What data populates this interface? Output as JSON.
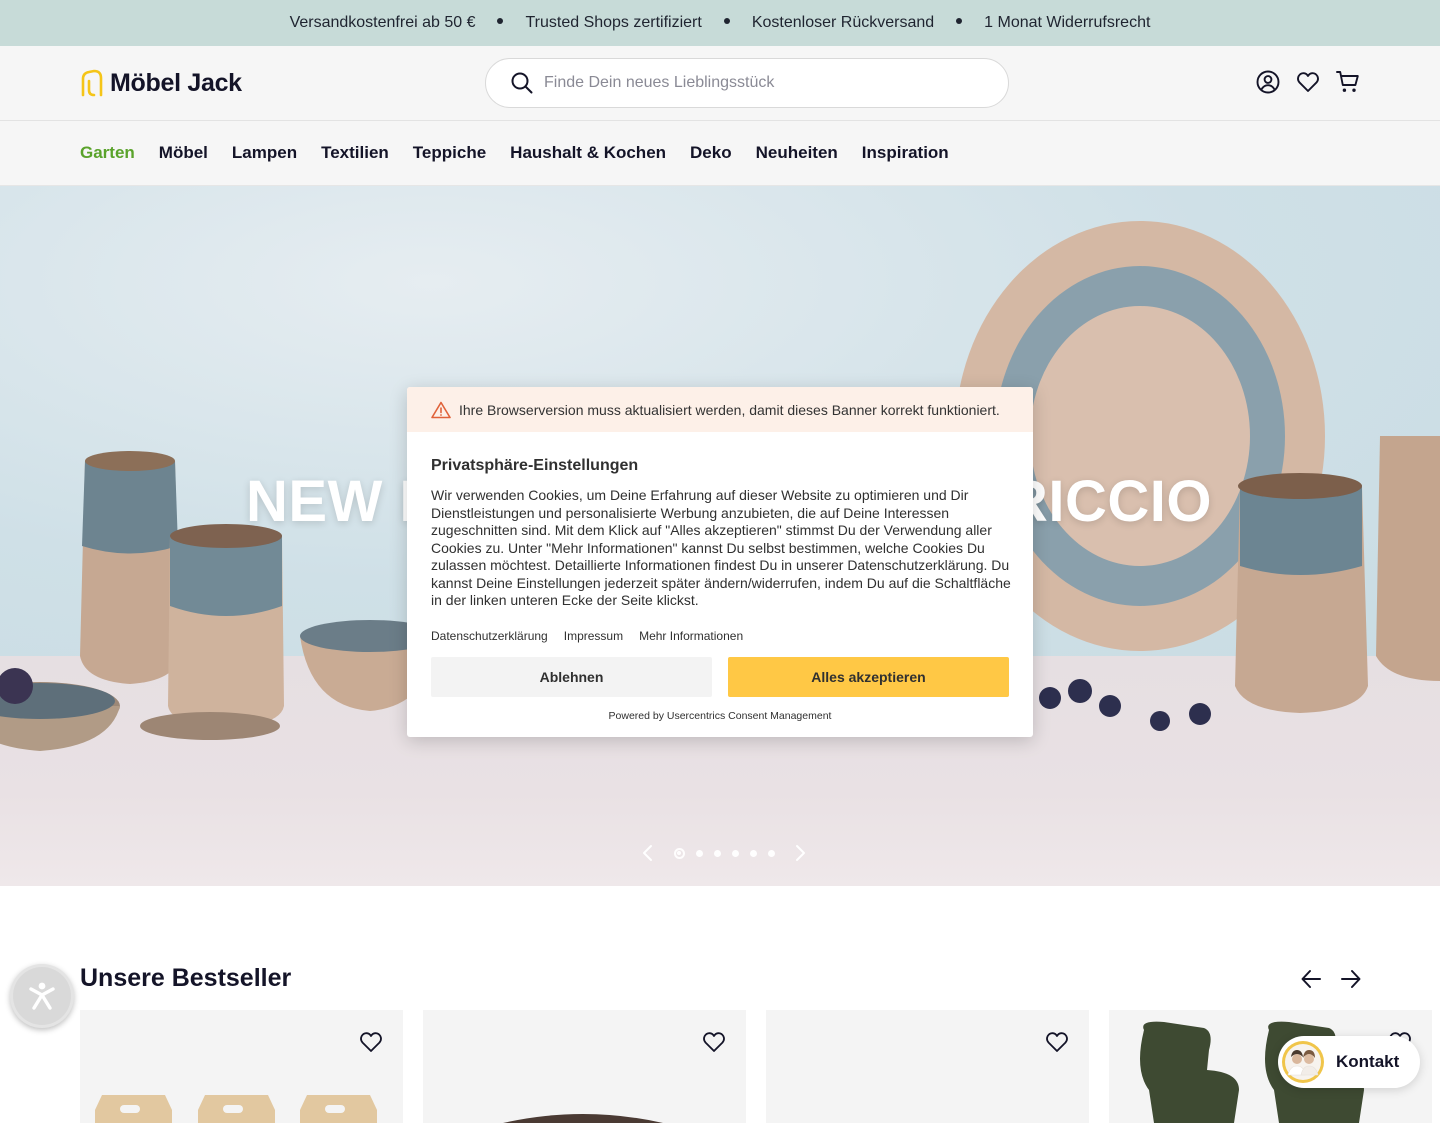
{
  "usp_bar": {
    "items": [
      "Versandkostenfrei ab 50 €",
      "Trusted Shops zertifiziert",
      "Kostenloser Rückversand",
      "1 Monat Widerrufsrecht"
    ]
  },
  "header": {
    "logo_text": "Möbel Jack",
    "search_placeholder": "Finde Dein neues Lieblingsstück",
    "icons": [
      "account-icon",
      "wishlist-icon",
      "cart-icon"
    ]
  },
  "nav": {
    "items": [
      {
        "label": "Garten",
        "active": true
      },
      {
        "label": "Möbel"
      },
      {
        "label": "Lampen"
      },
      {
        "label": "Textilien"
      },
      {
        "label": "Teppiche"
      },
      {
        "label": "Haushalt & Kochen"
      },
      {
        "label": "Deko"
      },
      {
        "label": "Neuheiten"
      },
      {
        "label": "Inspiration"
      }
    ],
    "active_color": "#5aa32b"
  },
  "hero": {
    "title_left": "NEW I",
    "title_right": "RICCIO",
    "slides_count": 6,
    "active_slide": 1
  },
  "consent": {
    "warning": "Ihre Browserversion muss aktualisiert werden, damit dieses Banner korrekt funktioniert.",
    "title": "Privatsphäre-Einstellungen",
    "text": "Wir verwenden Cookies, um Deine Erfahrung auf dieser Website zu optimieren und Dir Dienstleistungen und personalisierte Werbung anzubieten, die auf Deine Interessen zugeschnitten sind. Mit dem Klick auf \"Alles akzeptieren\" stimmst Du der Verwendung aller Cookies zu. Unter \"Mehr Informationen\" kannst Du selbst bestimmen, welche Cookies Du zulassen möchtest. Detaillierte Informationen findest Du in unserer Datenschutzerklärung. Du kannst Deine Einstellungen jederzeit später ändern/widerrufen, indem Du auf die Schaltfläche in der linken unteren Ecke der Seite klickst.",
    "links": [
      "Datenschutzerklärung",
      "Impressum",
      "Mehr Informationen"
    ],
    "deny_label": "Ablehnen",
    "accept_label": "Alles akzeptieren",
    "powered_by": "Powered by Usercentrics Consent Management",
    "accept_color": "#ffc845"
  },
  "bestseller": {
    "title": "Unsere Bestseller",
    "products_visible": 4
  },
  "kontakt": {
    "label": "Kontakt"
  }
}
